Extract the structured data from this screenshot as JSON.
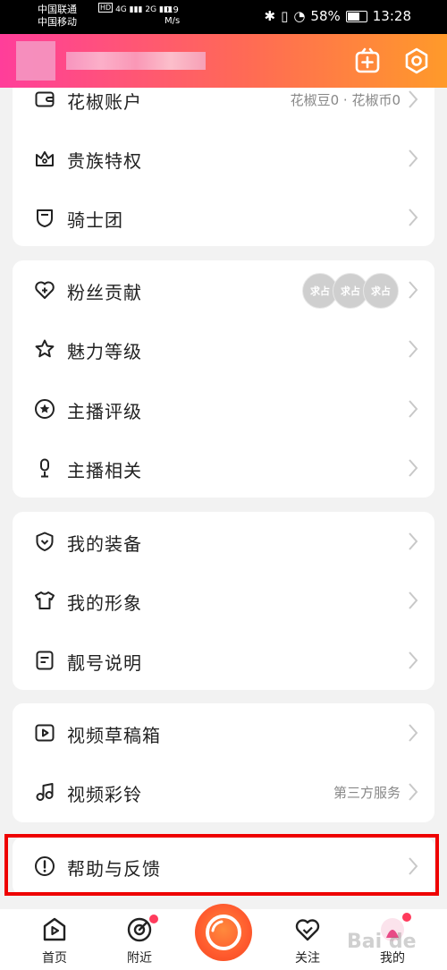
{
  "status_bar": {
    "carrier1": "中国联通",
    "carrier2": "中国移动",
    "hd": "HD",
    "net1": "4G",
    "net2": "2G",
    "speed_value": "0.9",
    "speed_unit": "M/s",
    "battery": "58%",
    "time": "13:28"
  },
  "colors": {
    "accent_start": "#ff3e9a",
    "accent_end": "#ff9a2a",
    "highlight": "#e00000"
  },
  "card1": {
    "items": [
      {
        "label": "花椒账户",
        "value": "花椒豆0 · 花椒币0",
        "icon": "wallet-icon"
      },
      {
        "label": "贵族特权",
        "value": "",
        "icon": "crown-icon"
      },
      {
        "label": "骑士团",
        "value": "",
        "icon": "shield-badge-icon"
      }
    ]
  },
  "card2": {
    "items": [
      {
        "label": "粉丝贡献",
        "icon": "heart-plus-icon",
        "badges": [
          "求占",
          "求占",
          "求占"
        ]
      },
      {
        "label": "魅力等级",
        "icon": "star-icon"
      },
      {
        "label": "主播评级",
        "icon": "star-circle-icon"
      },
      {
        "label": "主播相关",
        "icon": "microphone-icon"
      }
    ]
  },
  "card3": {
    "items": [
      {
        "label": "我的装备",
        "icon": "shield-check-icon"
      },
      {
        "label": "我的形象",
        "icon": "tshirt-icon"
      },
      {
        "label": "靓号说明",
        "icon": "document-icon"
      }
    ]
  },
  "card4": {
    "items": [
      {
        "label": "视频草稿箱",
        "value": "",
        "icon": "video-draft-icon"
      },
      {
        "label": "视频彩铃",
        "value": "第三方服务",
        "icon": "music-note-icon"
      }
    ]
  },
  "card5": {
    "items": [
      {
        "label": "帮助与反馈",
        "icon": "exclamation-circle-icon"
      }
    ]
  },
  "tabbar": {
    "home": "首页",
    "nearby": "附近",
    "follow": "关注",
    "mine": "我的"
  },
  "watermark": "Bai de"
}
